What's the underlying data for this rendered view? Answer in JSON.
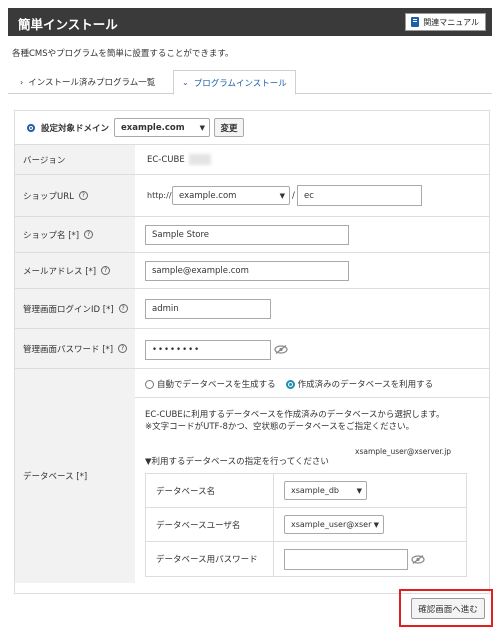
{
  "header": {
    "title": "簡単インストール",
    "manual_label": "関連マニュアル"
  },
  "intro": "各種CMSやプログラムを簡単に設置することができます。",
  "tabs": [
    {
      "label": "インストール済みプログラム一覧",
      "active": false
    },
    {
      "label": "プログラムインストール",
      "active": true
    }
  ],
  "domain": {
    "label": "設定対象ドメイン",
    "selected": "example.com",
    "change_label": "変更"
  },
  "fields": {
    "version": {
      "label": "バージョン",
      "value": "EC-CUBE"
    },
    "shop_url": {
      "label": "ショップURL",
      "prefix": "http://",
      "domain": "example.com",
      "separator": "/",
      "path": "ec"
    },
    "shop_name": {
      "label": "ショップ名 [*]",
      "value": "Sample Store"
    },
    "email": {
      "label": "メールアドレス [*]",
      "value": "sample@example.com"
    },
    "admin_id": {
      "label": "管理画面ログインID [*]",
      "value": "admin"
    },
    "admin_pw": {
      "label": "管理画面パスワード [*]",
      "value": "••••••••"
    }
  },
  "database": {
    "label": "データベース [*]",
    "option_auto": "自動でデータベースを生成する",
    "option_existing": "作成済みのデータベースを利用する",
    "selected": "existing",
    "note1": "EC-CUBEに利用するデータベースを作成済みのデータベースから選択します。",
    "note2": "※文字コードがUTF-8かつ、空状態のデータベースをご指定ください。",
    "spec_heading": "▼利用するデータベースの指定を行ってください",
    "user_hint": "xsample_user@xserver.jp",
    "db_name_label": "データベース名",
    "db_name_value": "xsample_db",
    "db_user_label": "データベースユーザ名",
    "db_user_value": "xsample_user@xserv",
    "db_pw_label": "データベース用パスワード"
  },
  "help_glyph": "?",
  "confirm_label": "確認画面へ進む",
  "colors": {
    "header_bg": "#3a3a3a",
    "accent": "#1d5fa8",
    "highlight": "#e02020"
  }
}
